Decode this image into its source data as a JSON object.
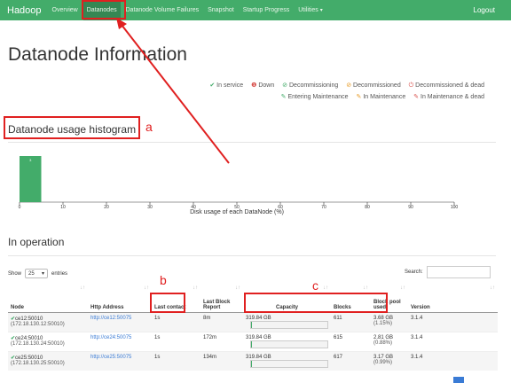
{
  "navbar": {
    "brand": "Hadoop",
    "items": [
      {
        "label": "Overview"
      },
      {
        "label": "Datanodes"
      },
      {
        "label": "Datanode Volume Failures"
      },
      {
        "label": "Snapshot"
      },
      {
        "label": "Startup Progress"
      },
      {
        "label": "Utilities"
      }
    ],
    "logout": "Logout"
  },
  "page_title": "Datanode Information",
  "legend": {
    "in_service": "In service",
    "down": "Down",
    "decommissioning": "Decommissioning",
    "decommissioned": "Decommissioned",
    "decommissioned_dead": "Decommissioned & dead",
    "entering_maintenance": "Entering Maintenance",
    "in_maintenance": "In Maintenance",
    "in_maintenance_dead": "In Maintenance & dead"
  },
  "histogram": {
    "title": "Datanode usage histogram",
    "xlabel": "Disk usage of each DataNode (%)",
    "bar_label": "3"
  },
  "chart_data": {
    "type": "bar",
    "categories": [
      "0-5"
    ],
    "values": [
      3
    ],
    "xlabel": "Disk usage of each DataNode (%)",
    "ylabel": "",
    "xticks": [
      "0",
      "10",
      "20",
      "30",
      "40",
      "50",
      "60",
      "70",
      "80",
      "90",
      "100"
    ],
    "xlim": [
      0,
      100
    ]
  },
  "operation": {
    "title": "In operation",
    "show_label": "Show",
    "show_value": "25",
    "entries_label": "entries",
    "search_label": "Search:",
    "columns": [
      "Node",
      "Http Address",
      "Last contact",
      "Last Block Report",
      "Capacity",
      "Blocks",
      "Block pool used",
      "Version"
    ],
    "rows": [
      {
        "node": "ce12:50010",
        "ip": "(172.18.130.12:50010)",
        "http": "http://ce12:50075",
        "contact": "1s",
        "report": "8m",
        "capacity": "319.84 GB",
        "fill": 0.0115,
        "blocks": "611",
        "pool": "3.68 GB",
        "pool_pct": "(1.15%)",
        "version": "3.1.4"
      },
      {
        "node": "ce24:50010",
        "ip": "(172.18.130.24:50010)",
        "http": "http://ce24:50075",
        "contact": "1s",
        "report": "172m",
        "capacity": "319.84 GB",
        "fill": 0.0088,
        "blocks": "615",
        "pool": "2.81 GB",
        "pool_pct": "(0.88%)",
        "version": "3.1.4"
      },
      {
        "node": "ce25:50010",
        "ip": "(172.18.130.25:50010)",
        "http": "http://ce25:50075",
        "contact": "1s",
        "report": "134m",
        "capacity": "319.84 GB",
        "fill": 0.0099,
        "blocks": "617",
        "pool": "3.17 GB",
        "pool_pct": "(0.99%)",
        "version": "3.1.4"
      }
    ]
  },
  "annotations": {
    "a": "a",
    "b": "b",
    "c": "c"
  },
  "colors": {
    "accent": "#43ac6a",
    "annotation": "#e02020",
    "link": "#3a7bd5"
  }
}
